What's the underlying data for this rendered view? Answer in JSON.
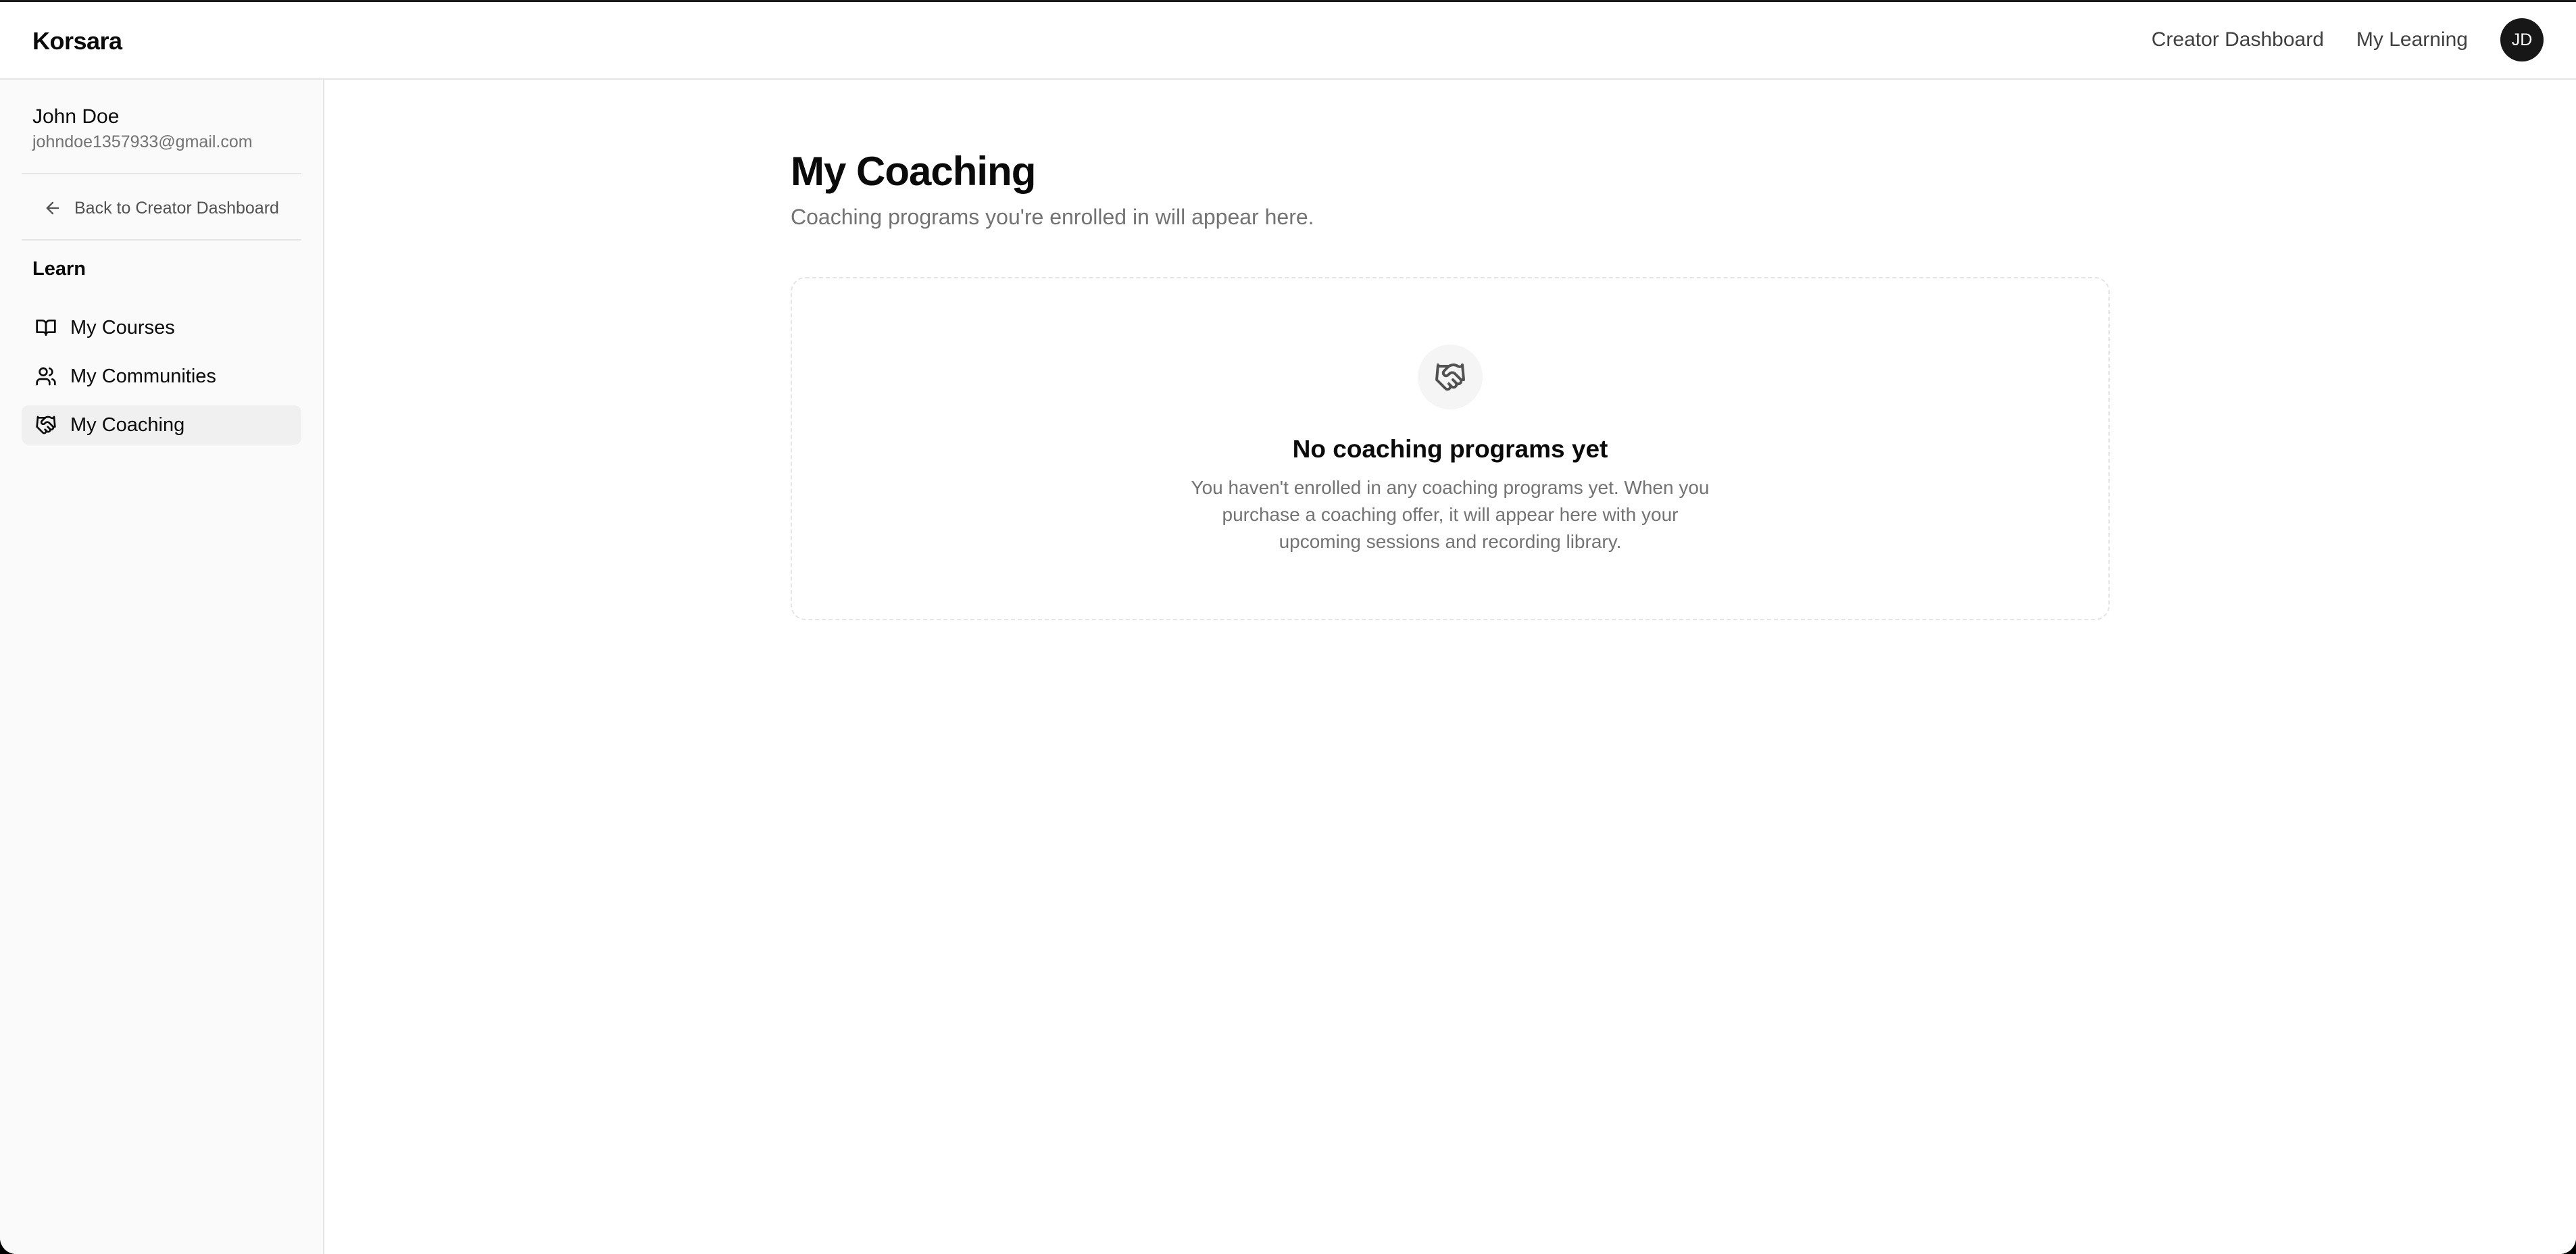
{
  "header": {
    "brand": "Korsara",
    "nav": [
      {
        "label": "Creator Dashboard"
      },
      {
        "label": "My Learning"
      }
    ],
    "avatar_initials": "JD"
  },
  "sidebar": {
    "user": {
      "name": "John Doe",
      "email": "johndoe1357933@gmail.com"
    },
    "back_label": "Back to Creator Dashboard",
    "section_label": "Learn",
    "items": [
      {
        "label": "My Courses",
        "icon": "book-open-icon"
      },
      {
        "label": "My Communities",
        "icon": "users-icon"
      },
      {
        "label": "My Coaching",
        "icon": "handshake-icon",
        "active": true
      }
    ]
  },
  "main": {
    "title": "My Coaching",
    "subtitle": "Coaching programs you're enrolled in will appear here.",
    "empty_state": {
      "icon": "handshake-icon",
      "title": "No coaching programs yet",
      "body": "You haven't enrolled in any coaching programs yet. When you purchase a coaching offer, it will appear here with your upcoming sessions and recording library."
    }
  },
  "colors": {
    "background": "#ffffff",
    "sidebar_background": "#fafafa",
    "active_item_background": "#f0f0f0",
    "avatar_background": "#171717",
    "muted_text": "#737373",
    "border": "#e5e5e5"
  }
}
